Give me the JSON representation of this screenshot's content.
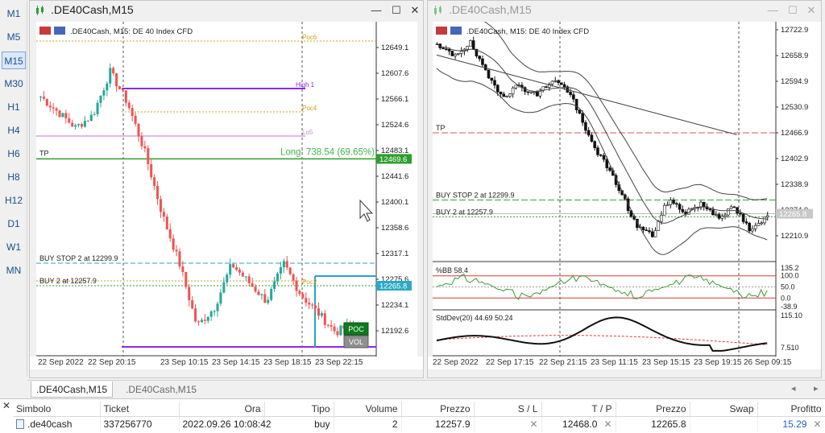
{
  "timeframes": [
    "M1",
    "M5",
    "M15",
    "M30",
    "H1",
    "H4",
    "H6",
    "H8",
    "H12",
    "D1",
    "W1",
    "MN"
  ],
  "active_timeframe": "M15",
  "left_window": {
    "title": ".DE40Cash,M15",
    "chart_caption": ".DE40Cash, M15:  DE 40 Index CFD",
    "price_labels": [
      "12649.1",
      "12607.6",
      "12566.1",
      "12524.6",
      "12483.1",
      "12441.6",
      "12400.1",
      "12358.6",
      "12317.1",
      "12275.6",
      "12234.1",
      "12192.6"
    ],
    "tag_tp_price": "12469.6",
    "tag_bid_price": "12265.8",
    "time_labels": [
      "22 Sep 2022",
      "22 Sep 20:15",
      "23 Sep 10:15",
      "23 Sep 14:15",
      "23 Sep 18:15",
      "23 Sep 22:15"
    ],
    "tp_label": "TP",
    "long_label": "Long: 738.54  (69.65%)",
    "buy_stop_label": "BUY STOP 2 at 12299.9",
    "buy_label": "BUY 2 at 12257.9",
    "poc_button": "POC",
    "vol_button": "VOL",
    "level_tags": [
      "Poc6",
      "High 1",
      "Poc4",
      "Lo5",
      "Poc2",
      "Poc3"
    ]
  },
  "right_window": {
    "title": ".DE40Cash,M15",
    "chart_caption": ".DE40Cash, M15:  DE 40 Index CFD",
    "price_labels": [
      "12722.9",
      "12658.9",
      "12594.9",
      "12530.9",
      "12466.9",
      "12402.9",
      "12338.9",
      "12274.9",
      "12210.9"
    ],
    "tag_bid_price": "12265.8",
    "tp_label": "TP",
    "buy_stop_label": "BUY STOP 2 at 12299.9",
    "buy_label": "BUY 2 at 12257.9",
    "bb_label": "%BB 58.4",
    "bb_scale": [
      "135.2",
      "100.0",
      "50.0",
      "0.0",
      "-38.9"
    ],
    "std_label": "StdDev(20) 44.69 50.24",
    "std_scale": [
      "115.10",
      "7.510"
    ],
    "time_labels": [
      "22 Sep 2022",
      "22 Sep 17:15",
      "22 Sep 21:15",
      "23 Sep 11:15",
      "23 Sep 15:15",
      "23 Sep 19:15",
      "26 Sep 09:15"
    ]
  },
  "tabs": {
    "active": ".DE40Cash,M15",
    "inactive": ".DE40Cash,M15"
  },
  "table": {
    "headers": [
      "Simbolo",
      "Ticket",
      "Ora",
      "Tipo",
      "Volume",
      "Prezzo",
      "S / L",
      "T / P",
      "Prezzo",
      "Swap",
      "Profitto"
    ],
    "row": {
      "symbol": ".de40cash",
      "ticket": "337256770",
      "time": "2022.09.26 10:08:42",
      "type": "buy",
      "volume": "2",
      "price_open": "12257.9",
      "sl": "",
      "tp": "12468.0",
      "price_current": "12265.8",
      "swap": "",
      "profit": "15.29"
    }
  },
  "colors": {
    "bull": "#26a69a",
    "bear": "#ef5350",
    "tp_line": "#2e9d2e",
    "buy_stop_line": "#27a3c8",
    "high_line": "#8a2be2",
    "poc_line": "#d4a017",
    "accent": "#1f5fc4"
  }
}
